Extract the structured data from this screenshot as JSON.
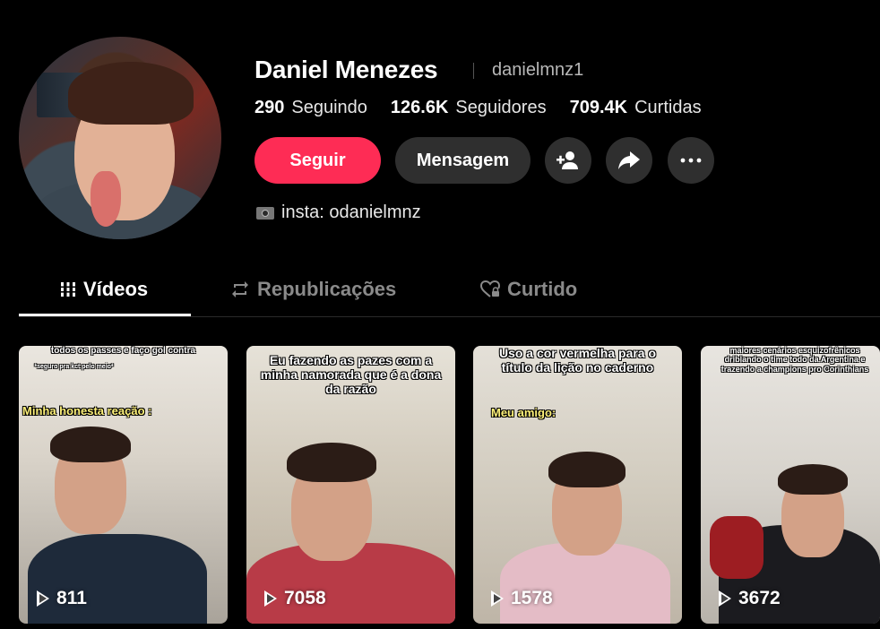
{
  "profile": {
    "name": "Daniel Menezes",
    "handle": "danielmnz1",
    "bio": "insta: odanielmnz",
    "stats": [
      {
        "value": "290",
        "label": "Seguindo"
      },
      {
        "value": "126.6K",
        "label": "Seguidores"
      },
      {
        "value": "709.4K",
        "label": "Curtidas"
      }
    ]
  },
  "actions": {
    "follow_label": "Seguir",
    "message_label": "Mensagem",
    "accent": "#fe2c55"
  },
  "tabs": [
    {
      "label": "Vídeos",
      "icon": "grid-icon",
      "active": true
    },
    {
      "label": "Republicações",
      "icon": "repost-icon",
      "active": false
    },
    {
      "label": "Curtido",
      "icon": "heart-lock-icon",
      "active": false
    }
  ],
  "videos": [
    {
      "views": "811",
      "caption_top": "todos os passes e faço gol contra",
      "caption_small": "*seguro pra kct pelo meio*",
      "caption_mid": "Minha honesta reação :"
    },
    {
      "views": "7058",
      "caption_top": "Eu fazendo as pazes com a minha namorada que é a dona da razão"
    },
    {
      "views": "1578",
      "caption_top": "Uso a cor vermelha para o título da lição no caderno",
      "caption_mid": "Meu amigo:"
    },
    {
      "views": "3672",
      "caption_top": "maiores cenários esquizofrênicos driblando o time todo da Argentina e trazendo a champions pro Corinthians"
    }
  ]
}
